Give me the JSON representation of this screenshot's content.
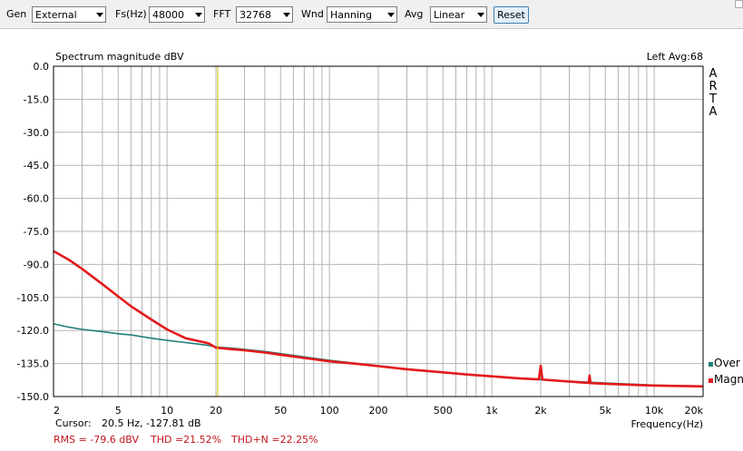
{
  "toolbar": {
    "gen_label": "Gen",
    "gen_value": "External",
    "fs_label": "Fs(Hz)",
    "fs_value": "48000",
    "fft_label": "FFT",
    "fft_value": "32768",
    "wnd_label": "Wnd",
    "wnd_value": "Hanning",
    "avg_label": "Avg",
    "avg_value": "Linear",
    "reset_label": "Reset"
  },
  "chart_data": {
    "type": "line",
    "title": "Spectrum magnitude dBV",
    "channel_info": "Left  Avg:68",
    "watermark": [
      "A",
      "R",
      "T",
      "A"
    ],
    "xlabel": "Frequency(Hz)",
    "ylabel": "",
    "x_scale": "log",
    "xlim": [
      2,
      20000
    ],
    "ylim": [
      -150,
      0
    ],
    "y_ticks": [
      "0.0",
      "-15.0",
      "-30.0",
      "-45.0",
      "-60.0",
      "-75.0",
      "-90.0",
      "-105.0",
      "-120.0",
      "-135.0",
      "-150.0"
    ],
    "x_ticks": [
      {
        "v": 2,
        "label": "2"
      },
      {
        "v": 5,
        "label": "5"
      },
      {
        "v": 10,
        "label": "10"
      },
      {
        "v": 20,
        "label": "20"
      },
      {
        "v": 50,
        "label": "50"
      },
      {
        "v": 100,
        "label": "100"
      },
      {
        "v": 200,
        "label": "200"
      },
      {
        "v": 500,
        "label": "500"
      },
      {
        "v": 1000,
        "label": "1k"
      },
      {
        "v": 2000,
        "label": "2k"
      },
      {
        "v": 5000,
        "label": "5k"
      },
      {
        "v": 10000,
        "label": "10k"
      },
      {
        "v": 20000,
        "label": "20k"
      }
    ],
    "grid": true,
    "cursor": {
      "x": 20.5,
      "label": "Cursor:",
      "readout": "20.5 Hz, -127.81 dB"
    },
    "stats": {
      "rms": "RMS =  -79.6 dBV",
      "thd": "THD =21.52%",
      "thdn": "THD+N =22.25%"
    },
    "legend_position": "bottom-right",
    "series": [
      {
        "name": "Over",
        "color": "#1f7f7a",
        "x": [
          2,
          2.5,
          3,
          4,
          5,
          6,
          8,
          10,
          13,
          15,
          18,
          20,
          25,
          30,
          40,
          50,
          70,
          100,
          150,
          200,
          300,
          500,
          700,
          1000,
          1500,
          2000,
          3000,
          5000,
          7000,
          10000,
          15000,
          20000
        ],
        "y": [
          -117,
          -118.5,
          -119.5,
          -120.5,
          -121.5,
          -122,
          -123.5,
          -124.5,
          -125.5,
          -126,
          -126.8,
          -127.5,
          -128,
          -128.6,
          -129.5,
          -130.5,
          -132,
          -133.5,
          -135,
          -136,
          -137.5,
          -139,
          -140,
          -140.8,
          -141.8,
          -142.3,
          -143,
          -143.8,
          -144.3,
          -144.8,
          -145.1,
          -145.3
        ]
      },
      {
        "name": "Magn",
        "color": "#e41a1c",
        "x": [
          2,
          2.5,
          3,
          4,
          5,
          6,
          8,
          10,
          13,
          15,
          18,
          20,
          25,
          30,
          40,
          50,
          70,
          100,
          150,
          200,
          300,
          500,
          700,
          1000,
          1500,
          1950,
          2000,
          2050,
          3000,
          3950,
          4000,
          4050,
          5000,
          7000,
          10000,
          15000,
          20000
        ],
        "y": [
          -84,
          -88,
          -92,
          -99,
          -104.5,
          -109,
          -115,
          -119.5,
          -123.5,
          -124.5,
          -125.8,
          -127.8,
          -128.5,
          -129,
          -130,
          -131,
          -132.5,
          -134,
          -135.2,
          -136.2,
          -137.6,
          -139,
          -140,
          -140.8,
          -141.8,
          -142.2,
          -136,
          -142.3,
          -143.2,
          -143.8,
          -140.5,
          -143.9,
          -144.2,
          -144.6,
          -145,
          -145.2,
          -145.4
        ]
      }
    ]
  }
}
